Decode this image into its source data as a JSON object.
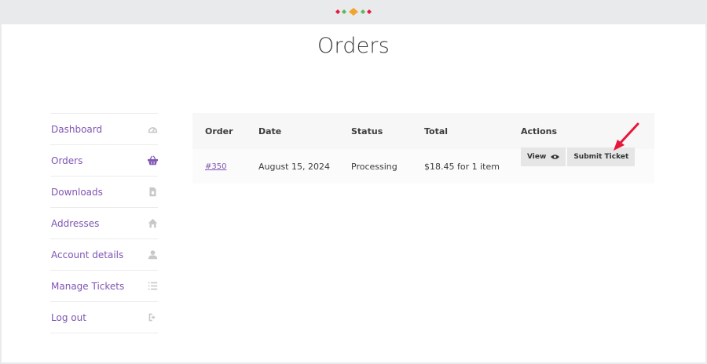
{
  "page": {
    "title": "Orders"
  },
  "sidebar": {
    "items": [
      {
        "label": "Dashboard",
        "icon": "dashboard-icon"
      },
      {
        "label": "Orders",
        "icon": "basket-icon",
        "active": true
      },
      {
        "label": "Downloads",
        "icon": "file-icon"
      },
      {
        "label": "Addresses",
        "icon": "home-icon"
      },
      {
        "label": "Account details",
        "icon": "user-icon"
      },
      {
        "label": "Manage Tickets",
        "icon": "list-icon"
      },
      {
        "label": "Log out",
        "icon": "logout-icon"
      }
    ]
  },
  "table": {
    "headers": {
      "order": "Order",
      "date": "Date",
      "status": "Status",
      "total": "Total",
      "actions": "Actions"
    },
    "rows": [
      {
        "order": "#350",
        "date": "August 15, 2024",
        "status": "Processing",
        "total": "$18.45 for 1 item",
        "view_label": "View",
        "ticket_label": "Submit Ticket"
      }
    ]
  },
  "colors": {
    "accent": "#7f54b3",
    "annotation_arrow": "#e8173a"
  }
}
